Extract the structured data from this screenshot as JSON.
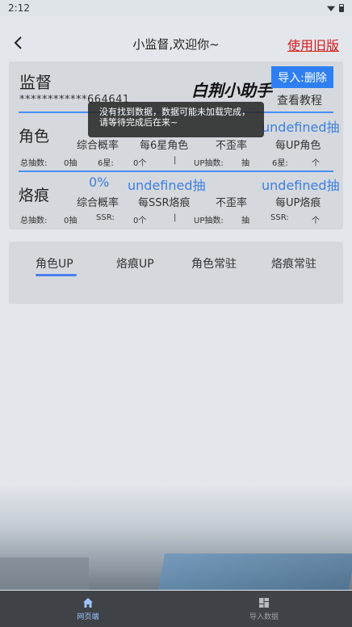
{
  "status_bar": {
    "time": "2:12"
  },
  "header": {
    "title": "小监督,欢迎你~",
    "old_version_label": "使用旧版"
  },
  "account_card": {
    "title": "监督",
    "account_id": "************664641",
    "logo_text": "白荆小助手",
    "import_button": "导入:删除",
    "tutorial_button": "查看教程"
  },
  "toast": {
    "message": "没有找到数据，数据可能未加载完成，请等待完成后在来~"
  },
  "character": {
    "label": "角色",
    "value_right": "undefined抽",
    "col_overall": "综合概率",
    "col_per_six": "每6星角色",
    "col_no_lose": "不歪率",
    "col_per_up": "每UP角色",
    "row_total_label": "总抽数:",
    "row_total_value": "0抽",
    "row_six_label": "6星:",
    "row_six_value": "0个",
    "row_sep": "|",
    "row_up_label": "UP抽数:",
    "row_up_value": "抽",
    "row_six_label2": "6星:",
    "row_six_value2": "个"
  },
  "imprint": {
    "label": "烙痕",
    "pct": "0%",
    "value_mid": "undefined抽",
    "value_right": "undefined抽",
    "col_overall": "综合概率",
    "col_per_ssr": "每SSR烙痕",
    "col_no_lose": "不歪率",
    "col_per_up": "每UP烙痕",
    "row_total_label": "总抽数:",
    "row_total_value": "0抽",
    "row_ssr_label": "SSR:",
    "row_ssr_value": "0个",
    "row_sep": "|",
    "row_up_label": "UP抽数:",
    "row_up_value": "抽",
    "row_ssr_label2": "SSR:",
    "row_ssr_value2": "个"
  },
  "tabs": [
    {
      "label": "角色UP"
    },
    {
      "label": "烙痕UP"
    },
    {
      "label": "角色常驻"
    },
    {
      "label": "烙痕常驻"
    }
  ],
  "bottom_nav": [
    {
      "label": "网页端",
      "icon": "home-icon"
    },
    {
      "label": "导入数据",
      "icon": "grid-icon"
    }
  ],
  "colors": {
    "accent": "#2f7ff2",
    "link_red": "#d81b1b",
    "value_blue": "#3f7fe0"
  }
}
